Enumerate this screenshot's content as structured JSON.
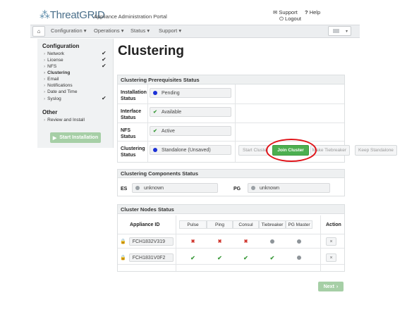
{
  "header": {
    "logo_text": "ThreatGRID",
    "logo_subtitle": "Appliance Administration Portal",
    "support_label": "Support",
    "help_label": "Help",
    "logout_label": "Logout"
  },
  "nav": {
    "items": [
      "Configuration",
      "Operations",
      "Status",
      "Support"
    ]
  },
  "sidebar": {
    "config_heading": "Configuration",
    "config_items": [
      {
        "label": "Network",
        "done": true
      },
      {
        "label": "License",
        "done": true
      },
      {
        "label": "NFS",
        "done": true
      },
      {
        "label": "Clustering",
        "done": false
      },
      {
        "label": "Email",
        "done": false
      },
      {
        "label": "Notifications",
        "done": false
      },
      {
        "label": "Date and Time",
        "done": false
      },
      {
        "label": "Syslog",
        "done": true
      }
    ],
    "other_heading": "Other",
    "other_items": [
      {
        "label": "Review and Install"
      }
    ],
    "start_button": "Start Installation"
  },
  "page": {
    "title": "Clustering"
  },
  "prereq": {
    "heading": "Clustering Prerequisites Status",
    "rows": [
      {
        "label": "Installation Status",
        "value": "Pending",
        "indicator": "dot-blue"
      },
      {
        "label": "Interface Status",
        "value": "Available",
        "indicator": "check"
      },
      {
        "label": "NFS Status",
        "value": "Active",
        "indicator": "check"
      },
      {
        "label": "Clustering Status",
        "value": "Standalone (Unsaved)",
        "indicator": "dot-blue"
      }
    ],
    "buttons": {
      "start_cluster": "Start Cluster",
      "join_cluster": "Join Cluster",
      "make_tiebreaker": "Make Tiebreaker",
      "keep_standalone": "Keep Standalone"
    }
  },
  "components": {
    "heading": "Clustering Components Status",
    "es_label": "ES",
    "es_value": "unknown",
    "pg_label": "PG",
    "pg_value": "unknown"
  },
  "nodes": {
    "heading": "Cluster Nodes Status",
    "columns": [
      "Appliance ID",
      "Pulse",
      "Ping",
      "Consul",
      "Tiebreaker",
      "PG Master",
      "Action"
    ],
    "rows": [
      {
        "id": "FCH1832V319",
        "status": [
          "x",
          "x",
          "x",
          "dot",
          "dot"
        ],
        "action": "×"
      },
      {
        "id": "FCH1831V0F2",
        "status": [
          "check",
          "check",
          "check",
          "check",
          "dot"
        ],
        "action": "×"
      }
    ]
  },
  "next_button": "Next",
  "colors": {
    "accent_green": "#4caf50",
    "disabled_green": "#a6cfa6",
    "error_red": "#d0342c",
    "highlight_circle": "#e0141a"
  }
}
